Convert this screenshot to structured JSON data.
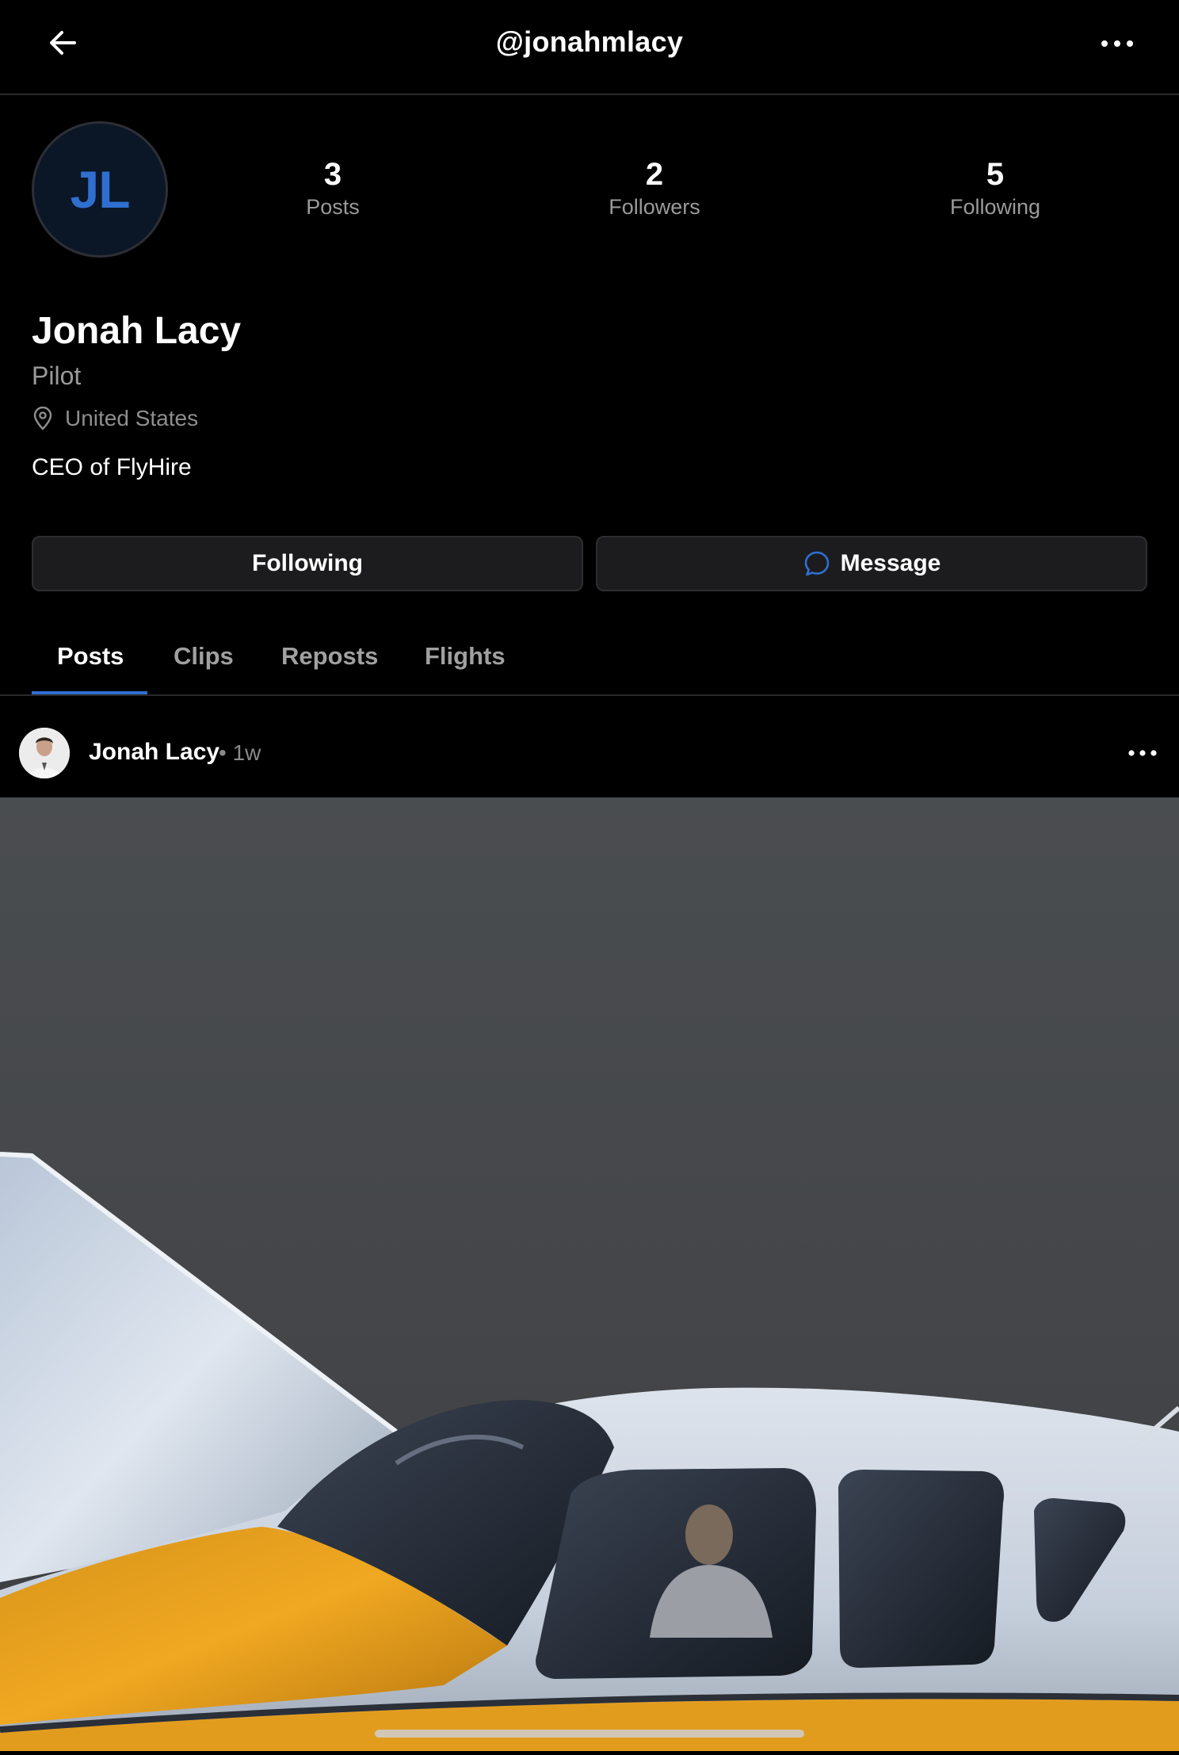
{
  "header": {
    "handle": "@jonahmlacy",
    "back_icon": "arrow-left-icon",
    "more_icon": "ellipsis-icon"
  },
  "profile": {
    "initials": "JL",
    "name": "Jonah Lacy",
    "role": "Pilot",
    "location": "United States",
    "bio": "CEO of FlyHire",
    "stats": [
      {
        "value": "3",
        "label": "Posts"
      },
      {
        "value": "2",
        "label": "Followers"
      },
      {
        "value": "5",
        "label": "Following"
      }
    ]
  },
  "actions": {
    "following_label": "Following",
    "message_label": "Message"
  },
  "tabs": [
    {
      "label": "Posts",
      "active": true
    },
    {
      "label": "Clips",
      "active": false
    },
    {
      "label": "Reposts",
      "active": false
    },
    {
      "label": "Flights",
      "active": false
    }
  ],
  "post": {
    "author": "Jonah Lacy",
    "time": "• 1w",
    "image_desc": "airplane-photo"
  },
  "colors": {
    "background": "#000000",
    "accent": "#2f6fd0",
    "button_bg": "#1c1c1e",
    "muted_text": "#9a9a9a"
  }
}
